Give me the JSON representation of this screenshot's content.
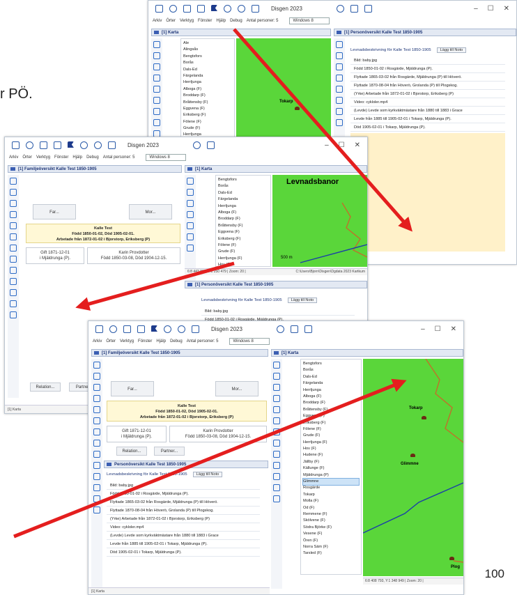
{
  "slide_text": "r PÖ.",
  "page_number": "100",
  "app": {
    "title": "Disgen 2023",
    "windows_combo": "Windows 8",
    "menu": [
      "Arkiv",
      "Órter",
      "Verktyg",
      "Fönster",
      "Hjälp",
      "Debug",
      "Antal personer: 5"
    ],
    "window_buttons": [
      "–",
      "☐",
      "✕"
    ]
  },
  "win1": {
    "map_panel_title": "[1] Karta",
    "person_panel_title": "[1] Personöversikt Kalle Test 1850-1905",
    "tree_items": [
      "Ale",
      "Alingsås",
      "Bengtsfors",
      "Borås",
      "Dals-Ed",
      "Färgelanda",
      "Herrljunga",
      "Alboga (F)",
      "Broddarp (F)",
      "Bråttensby (F)",
      "Eggvena (F)",
      "Eriksberg (F)",
      "Fölene (F)",
      "Grude (F)",
      "Herrljunga"
    ],
    "map_place": "Tokarp",
    "lev_header": "Levnadsbeskrivning för Kalle Test 1850-1905",
    "add_note": "Lägg till Noto",
    "rows": [
      "Bild: baby.jpg",
      "Född 1850-01-02 i Rosgärde, Mjäldrunga (P).",
      "Flyttade 1865-03-02 från Rosgärde, Mjäldrunga (P) till Höverö.",
      "Flyttade 1870-08-04 från Höverö, Grolanda (P) till Plogskog.",
      "(Yrke) Arbetade från 1872-01-02 i Bjorstorp, Eriksberg (P)",
      "Video: cykloler.mp4",
      "(Levde) Levde som kyrkväktmästare från 1880 till 1883 i Grace",
      "Levde från 1885 till 1905-02-01 i Tokarp, Mjäldrunga (P).",
      "Död 1905-02-01 i Tokarp, Mjäldrunga (P)."
    ]
  },
  "win2": {
    "family_panel_title": "[1] Familjeöversikt Kalle Test 1850-1905",
    "map_panel_title": "[1] Karta",
    "father_button": "Far...",
    "mother_button": "Mor...",
    "person_name": "Kalle Test",
    "person_dates": "Född 1850-01-02, Död 1905-02-01.",
    "person_work": "Arbetade från 1872-01-02 i Bjorstorp, Eriksberg (P)",
    "marriage": "Gift 1871-12-01",
    "marriage_place": "i Mjäldrunga (P).",
    "spouse": "Karin Provdotter",
    "spouse_dates": "Född 1850-03-08, Död 1904-12-15.",
    "relation_button": "Relation...",
    "partner_button": "Partner...",
    "map_title": "Levnadsbanor",
    "tree_items": [
      "Bengtsfors",
      "Borås",
      "Dals-Ed",
      "Färgelanda",
      "Herrljunga",
      "Alboga (F)",
      "Broddarp (F)",
      "Bråttensby (F)",
      "Eggvena (F)",
      "Eriksberg (F)",
      "Fölene (F)",
      "Grude (F)",
      "Herrljunga (F)",
      "Hov (F)"
    ],
    "scale": "500 m",
    "coords": "6:8 443 813, Y:1 250 479  | Zoom: 20 |",
    "path": "C:\\Users\\Bjorn\\Disgen\\Dgdata 2023 Kartkum",
    "person_panel_title": "[1] Personöversikt Kalle Test 1850-1905",
    "lev_header": "Levnadsbeskrivning för Kalle Test 1850-1905",
    "add_note": "Lägg till Noto",
    "rows": [
      "Bild: baby.jpg",
      "Född 1850-01-02 i Rosgärde, Mjäldrunga (P)."
    ],
    "status": "[1] Karta"
  },
  "win3": {
    "family_panel_title": "[1] Familjeöversikt Kalle Test 1850-1905",
    "map_panel_title": "[1] Karta",
    "father_button": "Far...",
    "mother_button": "Mor...",
    "person_name": "Kalle Test",
    "person_dates": "Född 1850-01-02, Död 1905-02-01.",
    "person_work": "Arbetade från 1872-01-02 i Bjorstorp, Eriksberg (P)",
    "marriage": "Gift 1871-12-01",
    "marriage_place": "i Mjäldrunga (P).",
    "spouse": "Karin Provdotter",
    "spouse_dates": "Född 1850-03-08, Död 1904-12-15.",
    "relation_button": "Relation...",
    "partner_button": "Partner...",
    "person_panel_title": "Personöversikt Kalle Test 1850-1905",
    "lev_header": "Levnadsbeskrivning för Kalle Test 1850-1905",
    "add_note": "Lägg till Noto",
    "rows": [
      "Bild: baby.jpg",
      "Född 1850-01-02 i Rosgärde, Mjäldrunga (P).",
      "Flyttade 1865-03-02 från Rosgärde, Mjäldrunga (P) till Höverö.",
      "Flyttade 1870-08-04 från Höverö, Grolanda (P) till Plogskog.",
      "(Yrke) Arbetade från 1872-01-02 i Bjorstorp, Eriksberg (P)",
      "Video: cykloler.mp4",
      "(Levde) Levde som kyrkväktmästare från 1880 till 1883 i Grace",
      "Levde från 1885 till 1905-02-01 i Tokarp, Mjäldrunga (P).",
      "Död 1905-02-01 i Tokarp, Mjäldrunga (P)."
    ],
    "tree_items": [
      "Bengtsfors",
      "Borås",
      "Dals-Ed",
      "Färgelanda",
      "Herrljunga",
      "Alboga (F)",
      "Broddarp (F)",
      "Bråttensby (F)",
      "Eggvena (F)",
      "Eriksberg (F)",
      "Fölene (F)",
      "Grude (F)",
      "Herrljunga (F)",
      "Hov (F)",
      "Hudene (F)",
      "Jällby (F)",
      "Källunge (F)",
      "Mjäldrunga (P)",
      "Glimmne",
      "Rosgärde",
      "Tokarp",
      "Molla (F)",
      "Od (F)",
      "Remmene (F)",
      "Skölvene (F)",
      "Södra Björke (F)",
      "Vesene (F)",
      "Ören (F)",
      "Norra Säm (F)",
      "Tarsled (F)"
    ],
    "map_places": [
      "Tokarp",
      "Glimmne",
      "Plog"
    ],
    "coords": "6:8 408 793, Y:1 348 949  | Zoom: 20 |",
    "status": "[1] Karta"
  }
}
